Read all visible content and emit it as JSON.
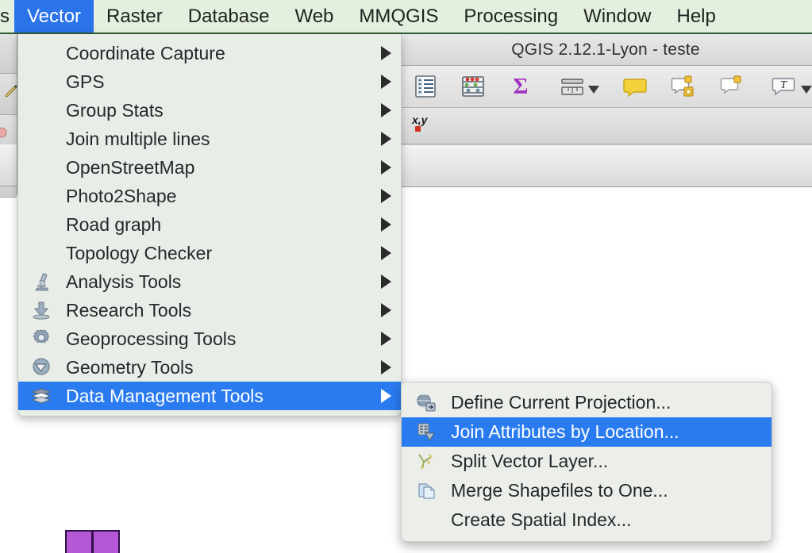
{
  "window": {
    "title": "QGIS 2.12.1-Lyon - teste"
  },
  "menubar": {
    "clipped_left_label": "s",
    "items": [
      {
        "label": "Vector",
        "active": true
      },
      {
        "label": "Raster",
        "active": false
      },
      {
        "label": "Database",
        "active": false
      },
      {
        "label": "Web",
        "active": false
      },
      {
        "label": "MMQGIS",
        "active": false
      },
      {
        "label": "Processing",
        "active": false
      },
      {
        "label": "Window",
        "active": false
      },
      {
        "label": "Help",
        "active": false
      }
    ]
  },
  "vector_menu": {
    "items": [
      {
        "label": "Coordinate Capture",
        "icon": "",
        "submenu": true,
        "selected": false
      },
      {
        "label": "GPS",
        "icon": "",
        "submenu": true,
        "selected": false
      },
      {
        "label": "Group Stats",
        "icon": "",
        "submenu": true,
        "selected": false
      },
      {
        "label": "Join multiple lines",
        "icon": "",
        "submenu": true,
        "selected": false
      },
      {
        "label": "OpenStreetMap",
        "icon": "",
        "submenu": true,
        "selected": false
      },
      {
        "label": "Photo2Shape",
        "icon": "",
        "submenu": true,
        "selected": false
      },
      {
        "label": "Road graph",
        "icon": "",
        "submenu": true,
        "selected": false
      },
      {
        "label": "Topology Checker",
        "icon": "",
        "submenu": true,
        "selected": false
      },
      {
        "label": "Analysis Tools",
        "icon": "microscope-icon",
        "submenu": true,
        "selected": false
      },
      {
        "label": "Research Tools",
        "icon": "download-arrow-icon",
        "submenu": true,
        "selected": false
      },
      {
        "label": "Geoprocessing Tools",
        "icon": "gear-icon",
        "submenu": true,
        "selected": false
      },
      {
        "label": "Geometry Tools",
        "icon": "geometry-icon",
        "submenu": true,
        "selected": false
      },
      {
        "label": "Data Management Tools",
        "icon": "layers-icon",
        "submenu": true,
        "selected": true
      }
    ]
  },
  "data_management_submenu": {
    "items": [
      {
        "label": "Define Current Projection...",
        "icon": "globe-projection-icon",
        "selected": false
      },
      {
        "label": "Join Attributes by Location...",
        "icon": "join-attributes-icon",
        "selected": true
      },
      {
        "label": "Split Vector Layer...",
        "icon": "split-layer-icon",
        "selected": false
      },
      {
        "label": "Merge Shapefiles to One...",
        "icon": "merge-shapefiles-icon",
        "selected": false
      },
      {
        "label": "Create Spatial Index...",
        "icon": "",
        "selected": false
      }
    ]
  },
  "toolbar": {
    "buttons": [
      {
        "name": "open-attribute-table-icon",
        "caret": false
      },
      {
        "name": "field-calculator-icon",
        "caret": false
      },
      {
        "name": "statistical-summary-icon",
        "caret": false
      },
      {
        "name": "measure-line-icon",
        "caret": true
      },
      {
        "name": "map-tips-icon",
        "caret": false
      },
      {
        "name": "new-annotation-locked-icon",
        "caret": false
      },
      {
        "name": "new-annotation-icon",
        "caret": false
      },
      {
        "name": "text-annotation-icon",
        "caret": true
      }
    ]
  },
  "statusbar": {
    "coordinate_label": "x,y"
  },
  "map_features": {
    "rect_count": 2,
    "fill_color": "#b558d6",
    "stroke_color": "#32104a"
  },
  "colors": {
    "menubar_bg": "#e4efdf",
    "menubar_border": "#2f5a33",
    "selection_blue": "#2a7bf0",
    "menubar_active_blue": "#2a73e8",
    "menu_panel_bg": "#e9ede8",
    "submenu_panel_bg": "#eceeea",
    "text": "#23282a",
    "canvas_bg": "#ffffff"
  }
}
